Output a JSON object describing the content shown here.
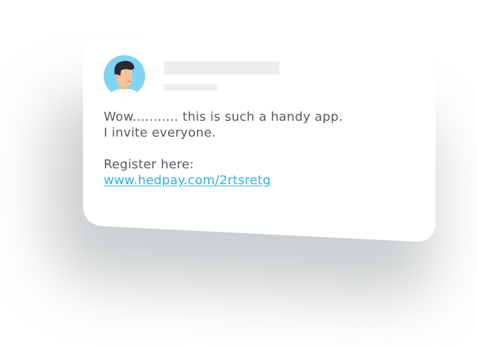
{
  "post": {
    "message_line1": "Wow........... this is such a handy app.",
    "message_line2": "I invite everyone.",
    "register_label": "Register here:",
    "link_text": "www.hedpay.com/2rtsretg"
  },
  "colors": {
    "link": "#2bb3e8",
    "text": "#555b60",
    "avatar_bg": "#7fd4f5",
    "placeholder": "#eceef0"
  },
  "icons": {
    "avatar": "user-avatar-icon"
  }
}
